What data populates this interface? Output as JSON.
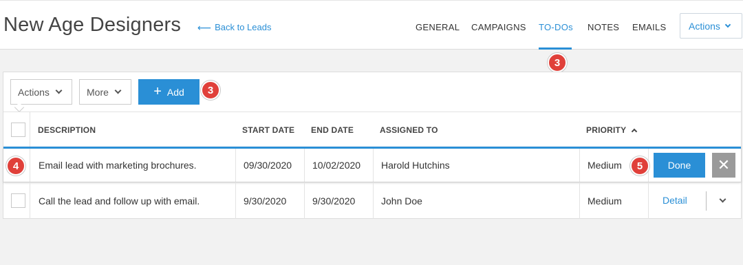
{
  "header": {
    "title": "New Age Designers",
    "back_label": "Back to Leads",
    "tabs": [
      {
        "label": "GENERAL"
      },
      {
        "label": "CAMPAIGNS"
      },
      {
        "label": "TO-DOs"
      },
      {
        "label": "NOTES"
      },
      {
        "label": "EMAILS"
      }
    ],
    "active_tab": "TO-DOs",
    "actions_label": "Actions"
  },
  "callouts": [
    "3",
    "3",
    "4",
    "5"
  ],
  "toolbar": {
    "actions_label": "Actions",
    "more_label": "More",
    "add_label": "Add"
  },
  "table": {
    "columns": [
      "DESCRIPTION",
      "START DATE",
      "END DATE",
      "ASSIGNED TO",
      "PRIORITY"
    ],
    "sort_column": "PRIORITY",
    "sort_direction": "ascending",
    "rows": [
      {
        "description": "Email lead with marketing brochures.",
        "start": "09/30/2020",
        "end": "10/02/2020",
        "assigned": "Harold Hutchins",
        "priority": "Medium",
        "action": "Done"
      },
      {
        "description": "Call the lead and follow up with email.",
        "start": "9/30/2020",
        "end": "9/30/2020",
        "assigned": "John Doe",
        "priority": "Medium",
        "action": "Detail"
      }
    ]
  },
  "colors": {
    "accent": "#2a8fd6",
    "badge": "#e0403a",
    "dismiss": "#9a9a9a"
  }
}
